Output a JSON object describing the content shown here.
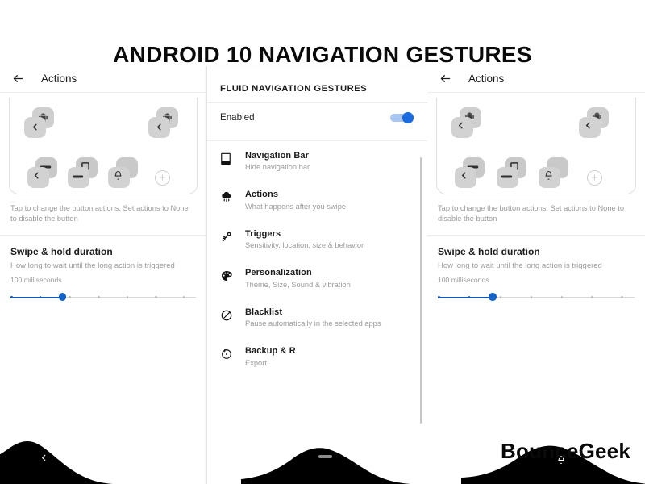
{
  "title": "ANDROID 10 NAVIGATION GESTURES",
  "watermark": "BounceGeek",
  "colors": {
    "accent_blue": "#1a6ae0",
    "slider_blue": "#1557b0",
    "track_gray": "#d7d7d7",
    "muted_text": "#9b9b9b",
    "primary_text": "#1b1b1b",
    "chip_gray": "#d2d2d2",
    "hill_black": "#000000"
  },
  "panels": {
    "left": {
      "appbar": {
        "back_icon": "arrow-left-icon",
        "title": "Actions"
      },
      "grid_card": {
        "items": [
          {
            "icon": "android-robot-icon",
            "chevron": "chevron-left-icon"
          },
          {
            "icon": "android-robot-icon",
            "chevron": "chevron-left-icon"
          },
          {
            "icon": "minus-pill-icon",
            "chevron": "chevron-left-icon"
          },
          {
            "icon": "square-overlap-icon",
            "chevron": "minus-pill-icon"
          },
          {
            "icon": "rounded-square-icon",
            "chevron": "bell-icon"
          }
        ],
        "add_button": {
          "icon": "plus-circle-icon",
          "label": "+"
        }
      },
      "hint": "Tap to change the button actions. Set actions to None to disable the button",
      "section": {
        "title": "Swipe & hold duration",
        "subtitle": "How long to wait until the long action is triggered",
        "value": "100 milliseconds",
        "slider": {
          "ticks": 7,
          "active_index": 2,
          "fill_percent": 28
        }
      },
      "hill": {
        "overlay_icon": "chevron-left-icon"
      }
    },
    "center": {
      "header": "FLUID NAVIGATION GESTURES",
      "enabled_row": {
        "label": "Enabled",
        "toggle_state": "on",
        "toggle_name": "enabled-toggle"
      },
      "items": [
        {
          "icon": "navigation-bar-icon",
          "title": "Navigation Bar",
          "subtitle": "Hide navigation bar"
        },
        {
          "icon": "actions-rain-icon",
          "title": "Actions",
          "subtitle": "What happens after you swipe"
        },
        {
          "icon": "triggers-swipe-icon",
          "title": "Triggers",
          "subtitle": "Sensitivity, location, size & behavior"
        },
        {
          "icon": "palette-icon",
          "title": "Personalization",
          "subtitle": "Theme, Size, Sound & vibration"
        },
        {
          "icon": "block-circle-icon",
          "title": "Blacklist",
          "subtitle": "Pause automatically in the selected apps"
        },
        {
          "icon": "backup-restore-icon",
          "title": "Backup & R",
          "subtitle": "Export"
        }
      ],
      "scrollbar": "vertical-scrollbar",
      "hill": {
        "overlay_icon": "home-indicator-pill"
      }
    },
    "right": {
      "appbar": {
        "back_icon": "arrow-left-icon",
        "title": "Actions"
      },
      "grid_card": {
        "items": [
          {
            "icon": "android-robot-icon",
            "chevron": "chevron-left-icon"
          },
          {
            "icon": "android-robot-icon",
            "chevron": "chevron-left-icon"
          },
          {
            "icon": "minus-pill-icon",
            "chevron": "chevron-left-icon"
          },
          {
            "icon": "square-overlap-icon",
            "chevron": "minus-pill-icon"
          },
          {
            "icon": "rounded-square-icon",
            "chevron": "bell-icon"
          }
        ],
        "add_button": {
          "icon": "plus-circle-icon",
          "label": "+"
        }
      },
      "hint": "Tap to change the button actions. Set actions to None to disable the button",
      "section": {
        "title": "Swipe & hold duration",
        "subtitle": "How long to wait until the long action is triggered",
        "value": "100 milliseconds",
        "slider": {
          "ticks": 7,
          "active_index": 2,
          "fill_percent": 28
        }
      },
      "hill": {
        "overlay_icon": "bell-icon"
      }
    }
  }
}
